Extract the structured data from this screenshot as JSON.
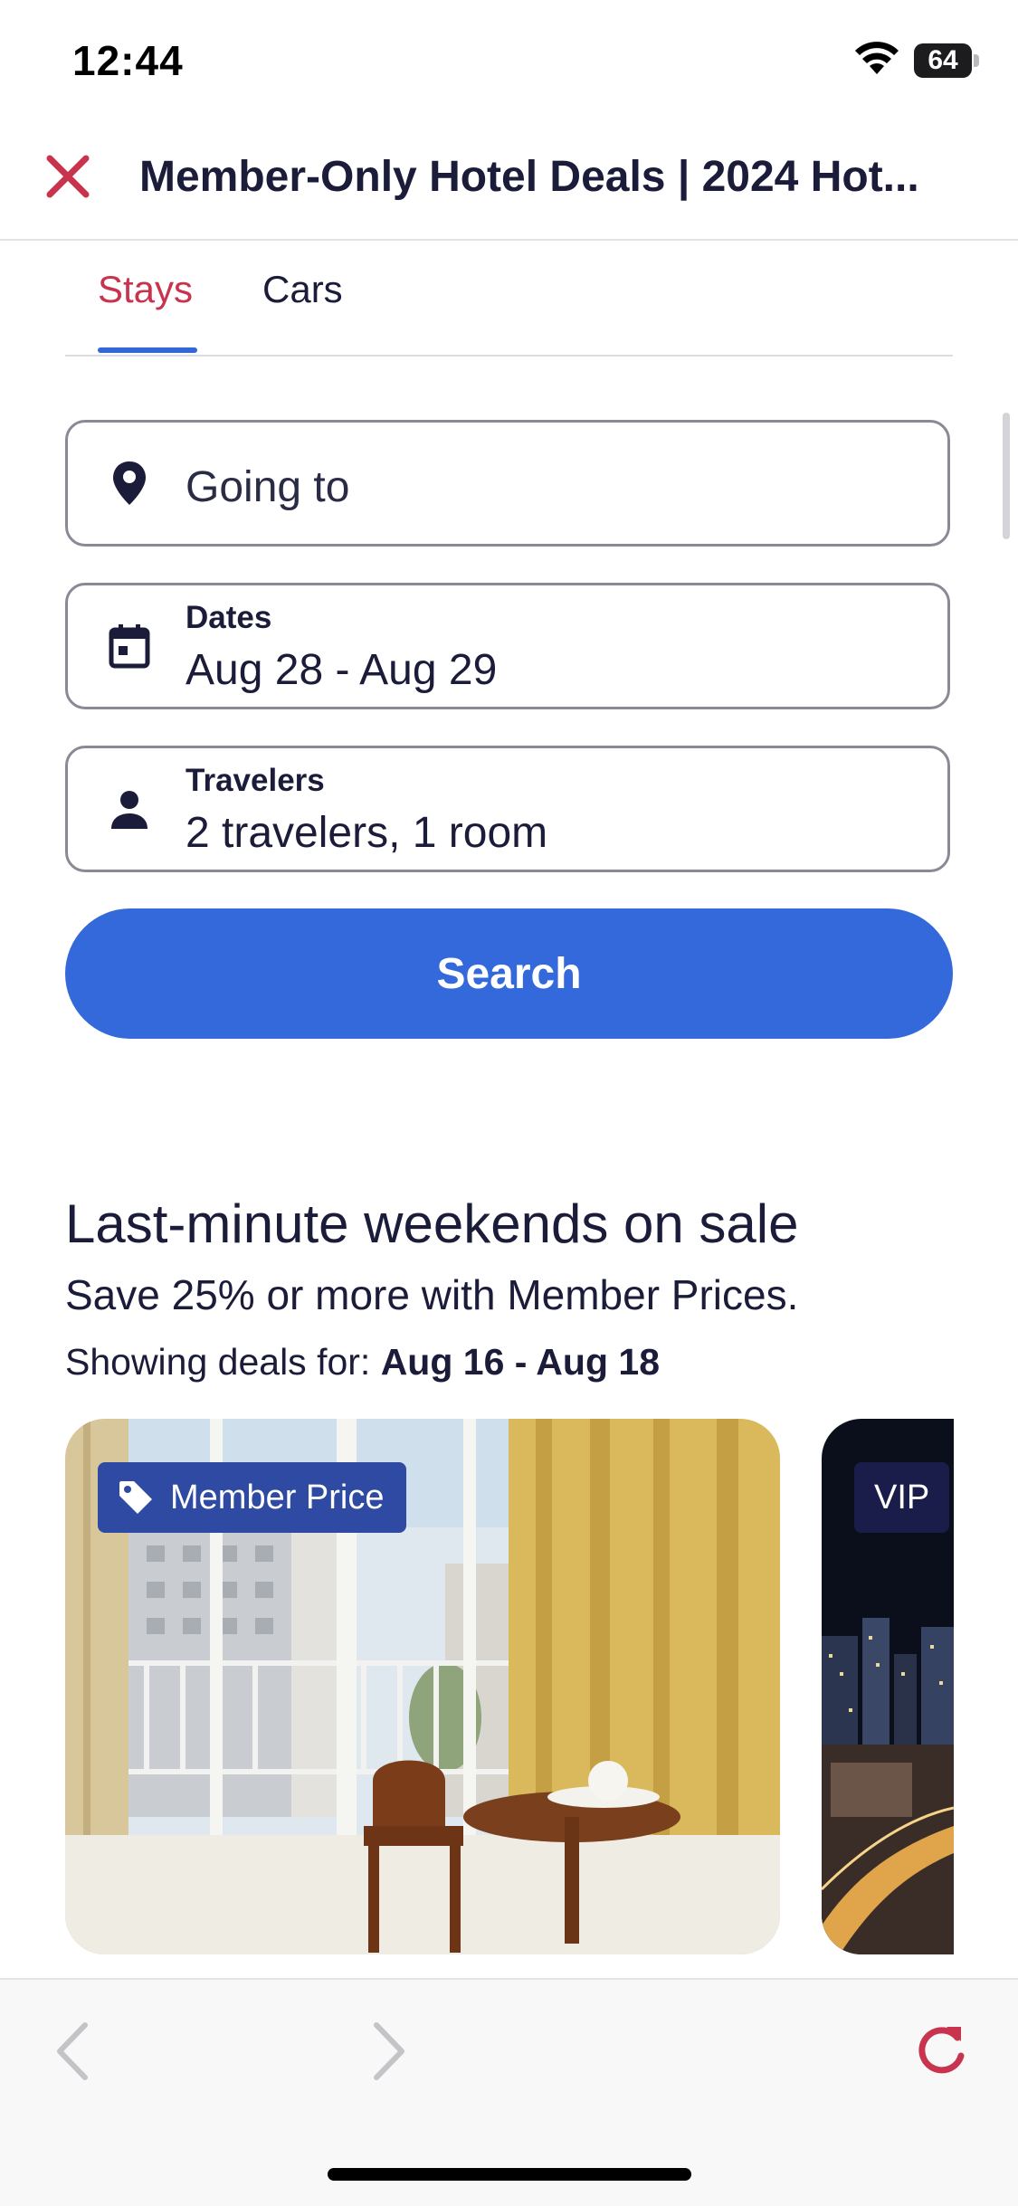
{
  "status_bar": {
    "time": "12:44",
    "battery": "64",
    "wifi_icon": "wifi-icon"
  },
  "header": {
    "title": "Member-Only Hotel Deals | 2024 Hot...",
    "close_icon": "close-icon",
    "accent_color": "#c8344e"
  },
  "tabs": [
    {
      "label": "Stays",
      "selected": true
    },
    {
      "label": "Cars",
      "selected": false
    }
  ],
  "search_form": {
    "destination": {
      "placeholder": "Going to",
      "icon": "location-pin-icon"
    },
    "dates": {
      "label": "Dates",
      "value": "Aug 28 - Aug 29",
      "icon": "calendar-icon"
    },
    "travelers": {
      "label": "Travelers",
      "value": "2 travelers, 1 room",
      "icon": "person-icon"
    },
    "search_button": "Search",
    "button_color": "#3369da"
  },
  "deals": {
    "title": "Last-minute weekends on sale",
    "subtitle": "Save 25% or more with Member Prices.",
    "showing_prefix": "Showing deals for: ",
    "showing_dates": "Aug 16 - Aug 18",
    "cards": [
      {
        "badge": "Member Price",
        "badge_icon": "tag-icon"
      },
      {
        "badge": "VIP"
      }
    ]
  },
  "browser_toolbar": {
    "back_icon": "chevron-left-icon",
    "forward_icon": "chevron-right-icon",
    "reload_icon": "reload-icon"
  }
}
